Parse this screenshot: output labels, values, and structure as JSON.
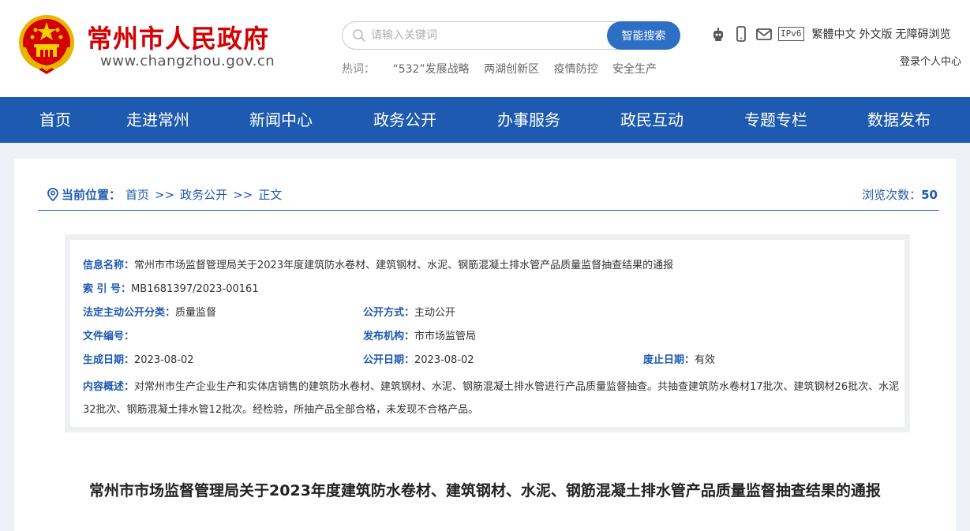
{
  "header": {
    "site_title": "常州市人民政府",
    "site_url": "www.changzhou.gov.cn",
    "search": {
      "placeholder": "请输入关键词",
      "button_label": "智能搜索"
    },
    "hotwords_label": "热词：",
    "hotwords": [
      "“532”发展战略",
      "两湖创新区",
      "疫情防控",
      "安全生产"
    ],
    "tools": {
      "ipv6": "IPv6",
      "traditional": "繁體中文",
      "foreign": "外文版",
      "accessible": "无障碍浏览"
    },
    "login": "登录个人中心"
  },
  "nav": [
    "首页",
    "走进常州",
    "新闻中心",
    "政务公开",
    "办事服务",
    "政民互动",
    "专题专栏",
    "数据发布"
  ],
  "breadcrumb": {
    "label": "当前位置：",
    "items": [
      "首页",
      "政务公开",
      "正文"
    ],
    "separator": ">>"
  },
  "views": {
    "label": "浏览次数：",
    "count": "50"
  },
  "info": {
    "name_label": "信息名称：",
    "name_value": "常州市市场监督管理局关于2023年度建筑防水卷材、建筑钢材、水泥、钢筋混凝土排水管产品质量监督抽查结果的通报",
    "index_label": "索 引 号：",
    "index_value": "MB1681397/2023-00161",
    "category_label": "法定主动公开分类：",
    "category_value": "质量监督",
    "method_label": "公开方式：",
    "method_value": "主动公开",
    "docno_label": "文件编号：",
    "docno_value": "",
    "publisher_label": "发布机构：",
    "publisher_value": "市市场监管局",
    "created_label": "生成日期：",
    "created_value": "2023-08-02",
    "published_label": "公开日期：",
    "published_value": "2023-08-02",
    "expiry_label": "废止日期：",
    "expiry_value": "有效",
    "summary_label": "内容概述：",
    "summary_value": "对常州市生产企业生产和实体店销售的建筑防水卷材、建筑钢材、水泥、钢筋混凝土排水管进行产品质量监督抽查。共抽查建筑防水卷材17批次、建筑钢材26批次、水泥32批次、钢筋混凝土排水管12批次。经检验，所抽产品全部合格，未发现不合格产品。"
  },
  "article": {
    "title": "常州市市场监督管理局关于2023年度建筑防水卷材、建筑钢材、水泥、钢筋混凝土排水管产品质量监督抽查结果的通报"
  },
  "colors": {
    "brand_red": "#d40000",
    "nav_blue": "#1f5ab1",
    "search_blue": "#2e6fc6"
  }
}
